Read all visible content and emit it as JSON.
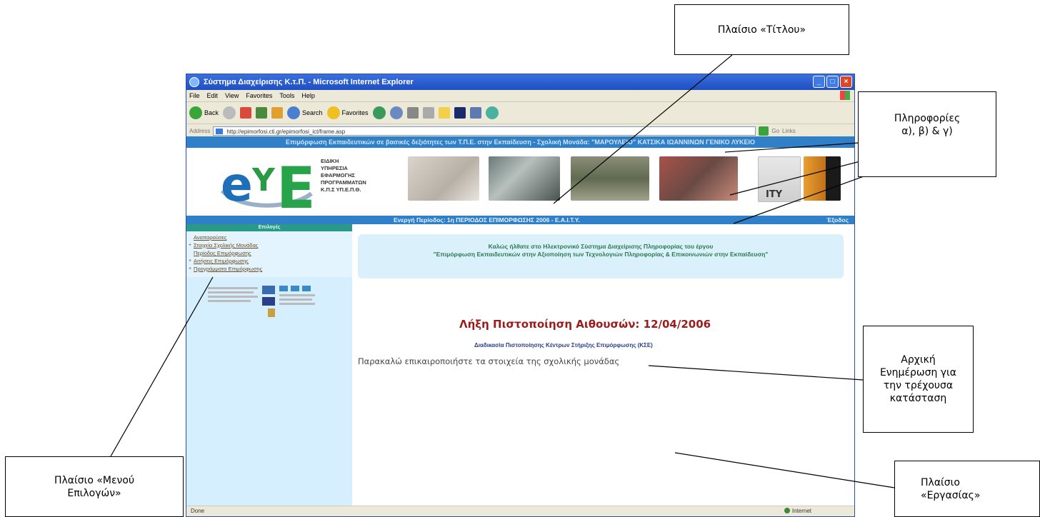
{
  "window": {
    "title": "Σύστημα Διαχείρισης Κ.τ.Π. - Microsoft Internet Explorer",
    "menu": [
      "File",
      "Edit",
      "View",
      "Favorites",
      "Tools",
      "Help"
    ],
    "toolbar": {
      "back": "Back",
      "search": "Search",
      "favorites": "Favorites"
    },
    "address_label": "Address",
    "address_url": "http://epimorfosi.cti.gr/epimorfosi_ict/frame.asp",
    "go_label": "Go",
    "links_label": "Links"
  },
  "page": {
    "header_strip": "Επιμόρφωση Εκπαιδευτικών σε βασικές δεξιότητες των Τ.Π.Ε. στην Εκπαίδευση - Σχολική Μονάδα: \"ΜΑΡΟΥΛΕΙΟ\" ΚΑΤΣΙΚΑ ΙΩΑΝΝΙΝΩΝ ΓΕΝΙΚΟ ΛΥΚΕΙΟ",
    "logo_text": "ΕΙΔΙΚΗ\nΥΠΗΡΕΣΙΑ\nΕΦΑΡΜΟΓΗΣ\nΠΡΟΓΡΑΜΜΑΤΩΝ\nΚ.Π.Σ ΥΠ.Ε.Π.Θ.",
    "period": "Ενεργή Περίοδος: 1η ΠΕΡΙΟΔΟΣ ΕΠΙΜΟΡΦΩΣΗΣ 2006 - Ε.Α.Ι.Τ.Υ.",
    "exit_link": "Έξοδος",
    "sidebar_heading": "Επιλογές",
    "menu_items": [
      "Αναπαρούσες",
      "Στοιχεία Σχολικής Μονάδας",
      "Περίοδος Επιμόρφωσης",
      "Αιτήσεις Επιμόρφωσης",
      "Προγράμματα Επιμόρφωσης"
    ],
    "welcome_text": "Καλώς ήλθατε στο Ηλεκτρονικό Σύστημα Διαχείρισης Πληροφορίας του έργου\n\"Επιμόρφωση Εκπαιδευτικών στην Αξιοποίηση των Τεχνολογιών Πληροφορίας & Επικοινωνιών στην Εκπαίδευση\"",
    "expiry_title": "Λήξη Πιστοποίηση Αιθουσών: 12/04/2006",
    "process_link": "Διαδικασία Πιστοποίησης Κέντρων Στήριξης Επιμόρφωσης (ΚΣΕ)",
    "update_message": "Παρακαλώ επικαιροποιήστε τα στοιχεία της σχολικής μονάδας",
    "status_done": "Done",
    "status_zone": "Internet"
  },
  "callouts": {
    "title_frame": "Πλαίσιο «Τίτλου»",
    "info": "Πληροφορίες\nα), β) & γ)",
    "menu_frame": "Πλαίσιο «Μενού\nΕπιλογών»",
    "initial_update": "Αρχική\nΕνημέρωση για\nτην τρέχουσα\nκατάσταση",
    "work_frame": "Πλαίσιο\n«Εργασίας»"
  }
}
